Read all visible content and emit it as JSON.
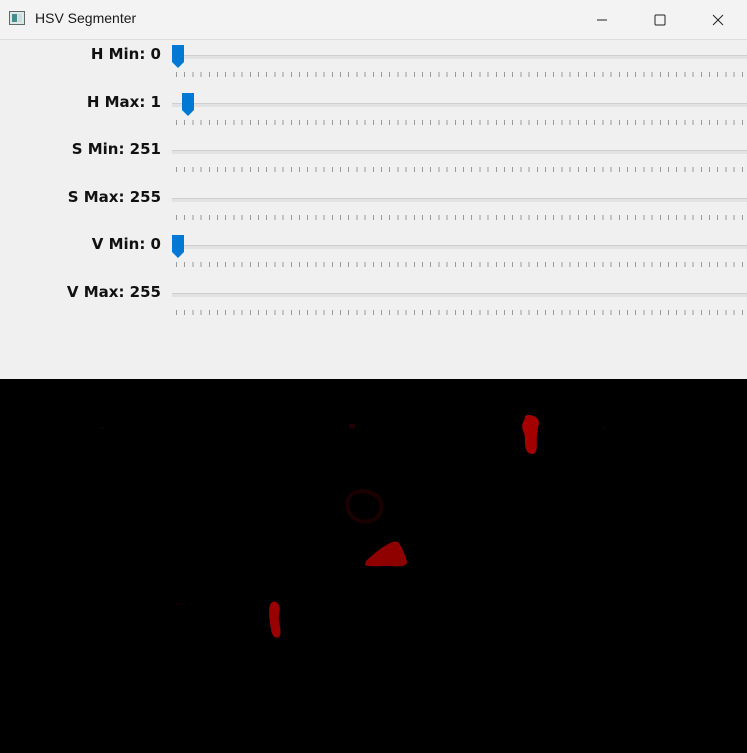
{
  "window": {
    "title": "HSV Segmenter",
    "controls": {
      "minimize": "minimize-icon",
      "maximize": "maximize-icon",
      "close": "close-icon"
    }
  },
  "sliders": [
    {
      "label": "H Min: 0",
      "value": 0,
      "fraction": 0.0
    },
    {
      "label": "H Max: 1",
      "value": 1,
      "fraction": 0.017
    },
    {
      "label": "S Min: 251",
      "value": 251,
      "fraction": null
    },
    {
      "label": "S Max: 255",
      "value": 255,
      "fraction": null
    },
    {
      "label": "V Min: 0",
      "value": 0,
      "fraction": 0.0
    },
    {
      "label": "V Max: 255",
      "value": 255,
      "fraction": null
    }
  ],
  "colors": {
    "accent": "#0078d4",
    "mask_background": "#000000",
    "segment": "#b00000"
  }
}
